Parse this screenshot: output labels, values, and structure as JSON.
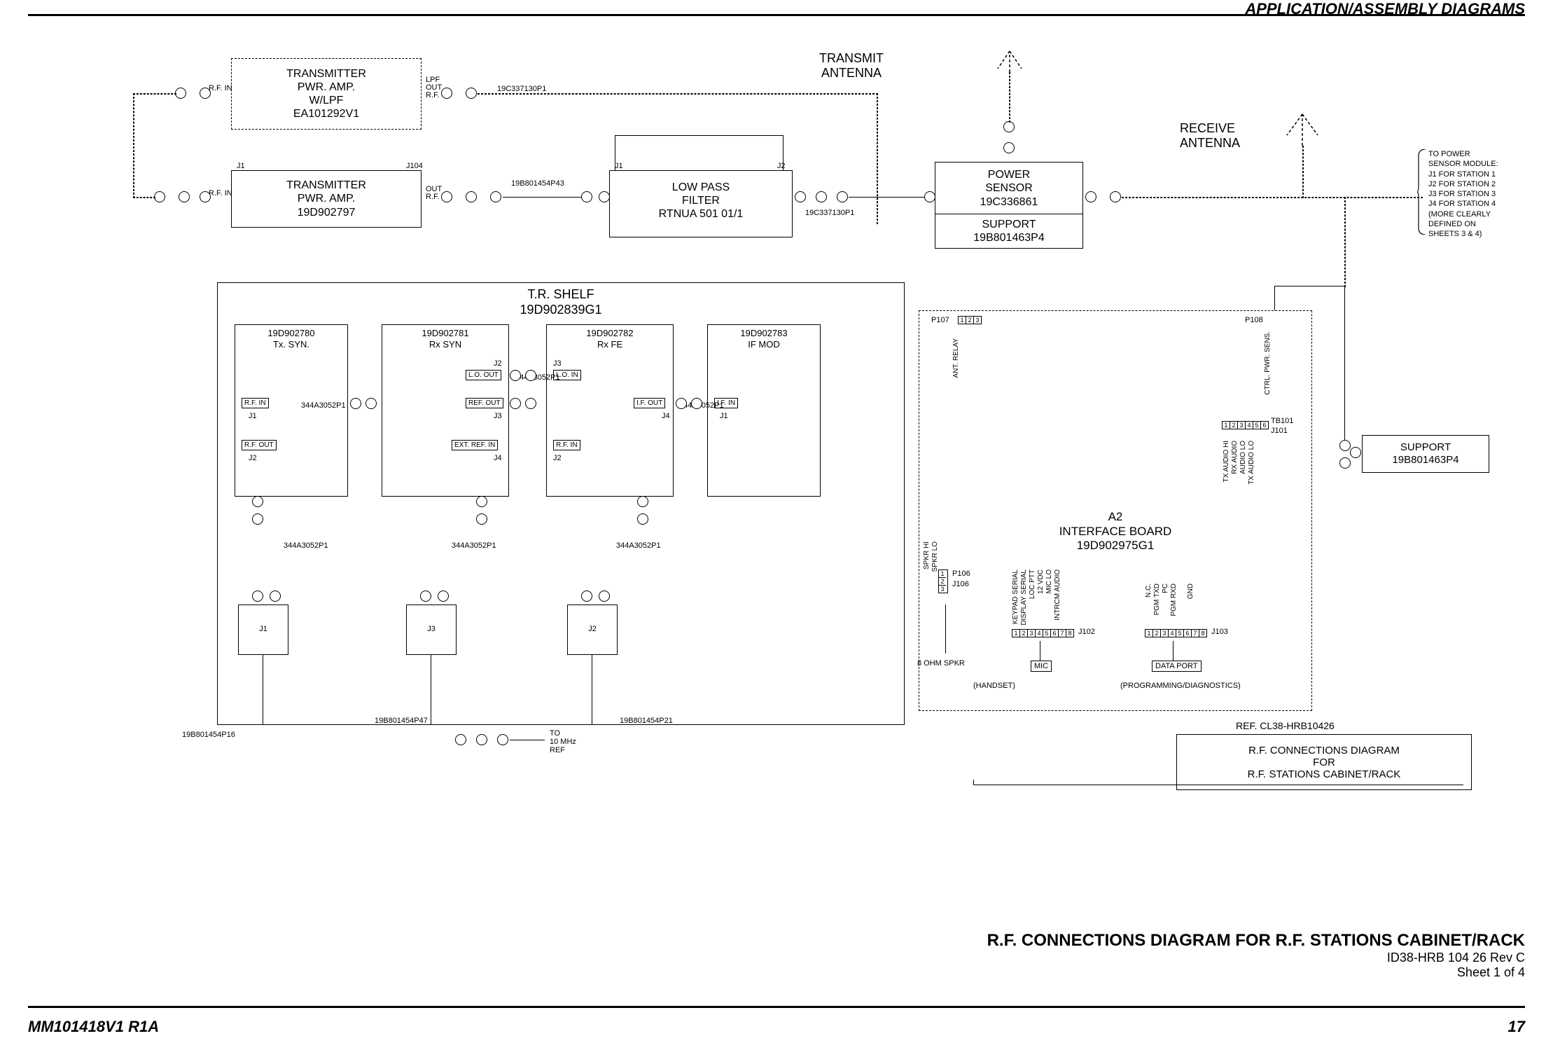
{
  "header": {
    "section_title": "APPLICATION/ASSEMBLY DIAGRAMS"
  },
  "footer": {
    "left": "MM101418V1 R1A",
    "right": "17"
  },
  "caption": {
    "title": "R.F. CONNECTIONS DIAGRAM FOR R.F. STATIONS CABINET/RACK",
    "id": "ID38-HRB 104 26 Rev C",
    "sheet": "Sheet 1 of 4"
  },
  "title_block": {
    "ref": "REF. CL38-HRB10426",
    "line1": "R.F.  CONNECTIONS   DIAGRAM",
    "line2": "FOR",
    "line3": "R.F.  STATIONS  CABINET/RACK"
  },
  "blocks": {
    "tx_pa_lpf": {
      "line1": "TRANSMITTER",
      "line2": "PWR. AMP.",
      "line3": "W/LPF",
      "line4": "EA101292V1",
      "left_port": "R.F. IN",
      "right_port1": "LPF",
      "right_port2": "OUT",
      "right_port3": "R.F."
    },
    "tx_pa": {
      "line1": "TRANSMITTER",
      "line2": "PWR. AMP.",
      "line3": "19D902797",
      "left_conn": "J1",
      "right_conn": "J104",
      "left_port": "R.F. IN",
      "right_port1": "OUT",
      "right_port2": "R.F."
    },
    "lpf": {
      "line1": "LOW PASS",
      "line2": "FILTER",
      "line3": "RTNUA 501 01/1",
      "left_conn": "J1",
      "right_conn": "J2"
    },
    "pwr_sensor": {
      "line1": "POWER",
      "line2": "SENSOR",
      "line3": "19C336861"
    },
    "support1": {
      "line1": "SUPPORT",
      "line2": "19B801463P4"
    },
    "support2": {
      "line1": "SUPPORT",
      "line2": "19B801463P4"
    },
    "tx_ant": "TRANSMIT ANTENNA",
    "rx_ant": "RECEIVE ANTENNA",
    "tr_shelf": {
      "title1": "T.R. SHELF",
      "title2": "19D902839G1"
    },
    "tx_syn": {
      "line1": "19D902780",
      "line2": "Tx. SYN.",
      "rf_in": "R.F. IN",
      "rf_out": "R.F. OUT",
      "j1": "J1",
      "j2": "J2"
    },
    "rx_syn": {
      "line1": "19D902781",
      "line2": "Rx SYN",
      "lo_out": "L.O. OUT",
      "ref_out": "REF. OUT",
      "ext_ref": "EXT. REF. IN",
      "j2": "J2",
      "j3": "J3",
      "j4": "J4"
    },
    "rx_fe": {
      "line1": "19D902782",
      "line2": "Rx FE",
      "lo_in": "L.O. IN",
      "if_out": "I.F. OUT",
      "rf_in": "R.F. IN",
      "j3": "J3",
      "j4": "J4",
      "j2": "J2"
    },
    "if_mod": {
      "line1": "19D902783",
      "line2": "IF MOD",
      "if_in": "I.F. IN",
      "j1": "J1"
    },
    "interface_board": {
      "line1": "A2",
      "line2": "INTERFACE BOARD",
      "line3": "19D902975G1",
      "p107": "P107",
      "p108": "P108",
      "ant_relay": "ANT. RELAY",
      "ctrl_pwr_sens": "CTRL. PWR. SENS.",
      "tb101": "TB101",
      "j101": "J101",
      "p106": "P106",
      "j106": "J106",
      "j102": "J102",
      "j103": "J103",
      "spkr_hi": "SPKR HI",
      "spkr_lo": "SPKR LO",
      "sig_tx_audio_hi": "TX AUDIO HI",
      "sig_rx_audio": "RX AUDIO",
      "sig_audio_lo": "AUDIO LO",
      "sig_tx_audio_lo": "TX AUDIO LO",
      "sig_keypad": "KEYPAD SERIAL",
      "sig_display": "DISPLAY SERIAL",
      "sig_loc_ptt": "LOC PTT",
      "sig_12vdc": "12 VDC",
      "sig_mic_lo": "MIC LO",
      "sig_intrcm": "INTRCM AUDIO",
      "sig_nc": "N.C.",
      "sig_pgm_txd": "PGM TXD",
      "sig_pc": "PC",
      "sig_pgm_rxd": "PGM RXD",
      "sig_gnd": "GND"
    },
    "handset": {
      "spkr": "8 OHM SPKR",
      "mic": "MIC",
      "label": "(HANDSET)"
    },
    "data_port": {
      "label1": "DATA PORT",
      "label2": "(PROGRAMMING/DIAGNOSTICS)"
    },
    "to_10mhz": {
      "line1": "TO",
      "line2": "10 MHz",
      "line3": "REF"
    },
    "sensor_note": {
      "line1": "TO POWER",
      "line2": "SENSOR MODULE:",
      "line3": "J1 FOR STATION 1",
      "line4": "J2 FOR STATION 2",
      "line5": "J3 FOR STATION 3",
      "line6": "J4 FOR STATION 4",
      "line7": "(MORE CLEARLY",
      "line8": "DEFINED ON",
      "line9": "SHEETS 3 & 4)"
    }
  },
  "cables": {
    "c1": "19C337130P1",
    "c2": "19B801454P43",
    "c3": "19C337130P1",
    "c4": "344A3052P1",
    "c5": "344A3052P1",
    "c6": "344A3052P1",
    "c7": "344A3052P1",
    "c8": "344A3052P1",
    "c9": "19B801454P16",
    "c10": "19B801454P47",
    "c11": "19B801454P21"
  },
  "connectors": {
    "j1": "J1",
    "j2": "J2",
    "j3": "J3",
    "j4": "J4"
  }
}
